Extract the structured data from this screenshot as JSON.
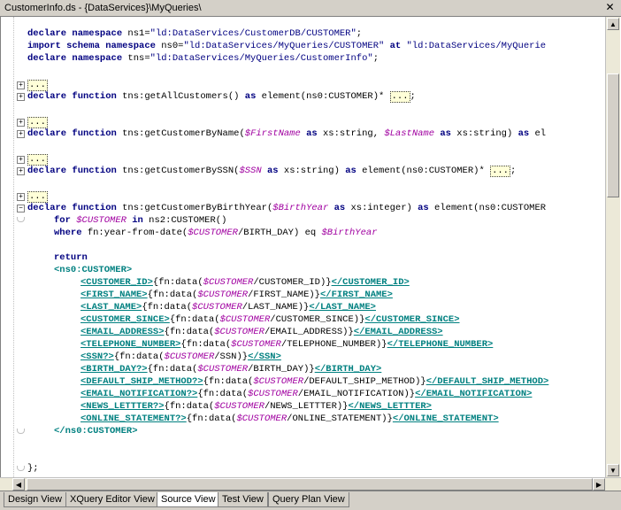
{
  "window": {
    "title": "CustomerInfo.ds - {DataServices}\\MyQueries\\"
  },
  "folded": "...",
  "code": {
    "l1": {
      "a": "declare namespace",
      "b": " ns1=",
      "c": "\"ld:DataServices/CustomerDB/CUSTOMER\"",
      "d": ";"
    },
    "l2": {
      "a": "import schema namespace",
      "b": " ns0=",
      "c": "\"ld:DataServices/MyQueries/CUSTOMER\"",
      "d": " ",
      "e": "at",
      "f": " ",
      "g": "\"ld:DataServices/MyQuerie"
    },
    "l3": {
      "a": "declare namespace",
      "b": " tns=",
      "c": "\"ld:DataServices/MyQueries/CustomerInfo\"",
      "d": ";"
    },
    "l5": {
      "a": "declare function",
      "b": " tns:getAllCustomers() ",
      "c": "as",
      "d": " element(ns0:CUSTOMER)* ",
      "e": ";"
    },
    "l7": {
      "a": "declare function",
      "b": " tns:getCustomerByName(",
      "c": "$FirstName",
      "d": " ",
      "e": "as",
      "f": " xs:string, ",
      "g": "$LastName",
      "h": " ",
      "i": "as",
      "j": " xs:string) ",
      "k": "as",
      "l": " el"
    },
    "l9": {
      "a": "declare function",
      "b": " tns:getCustomerBySSN(",
      "c": "$SSN",
      "d": " ",
      "e": "as",
      "f": " xs:string) ",
      "g": "as",
      "h": " element(ns0:CUSTOMER)* ",
      "i": ";"
    },
    "l11": {
      "a": "declare function",
      "b": " tns:getCustomerByBirthYear(",
      "c": "$BirthYear",
      "d": " ",
      "e": "as",
      "f": " xs:integer) ",
      "g": "as",
      "h": " element(ns0:CUSTOMER"
    },
    "l12": {
      "a": "for",
      "b": " ",
      "c": "$CUSTOMER",
      "d": " ",
      "e": "in",
      "f": " ns2:CUSTOMER()"
    },
    "l13": {
      "a": "where",
      "b": " fn:year-from-date(",
      "c": "$CUSTOMER",
      "d": "/BIRTH_DAY) eq ",
      "e": "$BirthYear"
    },
    "l15": {
      "a": "return"
    },
    "l16": {
      "a": "<ns0:CUSTOMER>"
    },
    "fields": [
      {
        "open": "<CUSTOMER_ID>",
        "pre": "{fn:data(",
        "var": "$CUSTOMER",
        "path": "/CUSTOMER_ID)}",
        "close": "</CUSTOMER_ID>"
      },
      {
        "open": "<FIRST_NAME>",
        "pre": "{fn:data(",
        "var": "$CUSTOMER",
        "path": "/FIRST_NAME)}",
        "close": "</FIRST_NAME>"
      },
      {
        "open": "<LAST_NAME>",
        "pre": "{fn:data(",
        "var": "$CUSTOMER",
        "path": "/LAST_NAME)}",
        "close": "</LAST_NAME>"
      },
      {
        "open": "<CUSTOMER_SINCE>",
        "pre": "{fn:data(",
        "var": "$CUSTOMER",
        "path": "/CUSTOMER_SINCE)}",
        "close": "</CUSTOMER_SINCE>"
      },
      {
        "open": "<EMAIL_ADDRESS>",
        "pre": "{fn:data(",
        "var": "$CUSTOMER",
        "path": "/EMAIL_ADDRESS)}",
        "close": "</EMAIL_ADDRESS>"
      },
      {
        "open": "<TELEPHONE_NUMBER>",
        "pre": "{fn:data(",
        "var": "$CUSTOMER",
        "path": "/TELEPHONE_NUMBER)}",
        "close": "</TELEPHONE_NUMBER>"
      },
      {
        "open": "<SSN?>",
        "pre": "{fn:data(",
        "var": "$CUSTOMER",
        "path": "/SSN)}",
        "close": "</SSN>"
      },
      {
        "open": "<BIRTH_DAY?>",
        "pre": "{fn:data(",
        "var": "$CUSTOMER",
        "path": "/BIRTH_DAY)}",
        "close": "</BIRTH_DAY>"
      },
      {
        "open": "<DEFAULT_SHIP_METHOD?>",
        "pre": "{fn:data(",
        "var": "$CUSTOMER",
        "path": "/DEFAULT_SHIP_METHOD)}",
        "close": "</DEFAULT_SHIP_METHOD>"
      },
      {
        "open": "<EMAIL_NOTIFICATION?>",
        "pre": "{fn:data(",
        "var": "$CUSTOMER",
        "path": "/EMAIL_NOTIFICATION)}",
        "close": "</EMAIL_NOTIFICATION>"
      },
      {
        "open": "<NEWS_LETTTER?>",
        "pre": "{fn:data(",
        "var": "$CUSTOMER",
        "path": "/NEWS_LETTTER)}",
        "close": "</NEWS_LETTTER>"
      },
      {
        "open": "<ONLINE_STATEMENT?>",
        "pre": "{fn:data(",
        "var": "$CUSTOMER",
        "path": "/ONLINE_STATEMENT)}",
        "close": "</ONLINE_STATEMENT>"
      }
    ],
    "l29": {
      "a": "</ns0:CUSTOMER>"
    },
    "l32": {
      "a": "};"
    }
  },
  "tabs": [
    {
      "label": "Design View"
    },
    {
      "label": "XQuery Editor View"
    },
    {
      "label": "Source View",
      "active": true
    },
    {
      "label": "Test View"
    },
    {
      "label": "Query Plan View"
    }
  ],
  "colors": {
    "keyword": "#000080",
    "variable": "#a000a0",
    "tag": "#008080",
    "tab_bar": "#d4d0c8"
  },
  "icons": {
    "close": "close-icon",
    "expand": "plus-icon",
    "collapse": "minus-icon",
    "scroll_up": "up-arrow-icon",
    "scroll_down": "down-arrow-icon",
    "scroll_left": "left-arrow-icon",
    "scroll_right": "right-arrow-icon"
  }
}
